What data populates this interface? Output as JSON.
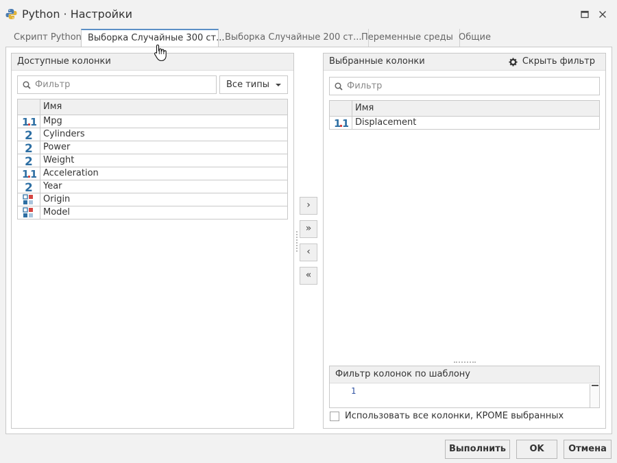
{
  "window": {
    "title": "Python · Настройки"
  },
  "tabs": [
    {
      "label": "Скрипт Python"
    },
    {
      "label": "Выборка Случайные 300 ст..."
    },
    {
      "label": "Выборка Случайные 200 ст..."
    },
    {
      "label": "Переменные среды"
    },
    {
      "label": "Общие"
    }
  ],
  "available": {
    "title": "Доступные колонки",
    "filter_placeholder": "Фильтр",
    "type_select": "Все типы",
    "column_header": "Имя",
    "columns": [
      {
        "name": "Mpg",
        "type_icon": "decimal-type-icon"
      },
      {
        "name": "Cylinders",
        "type_icon": "integer-type-icon"
      },
      {
        "name": "Power",
        "type_icon": "integer-type-icon"
      },
      {
        "name": "Weight",
        "type_icon": "integer-type-icon"
      },
      {
        "name": "Acceleration",
        "type_icon": "decimal-type-icon"
      },
      {
        "name": "Year",
        "type_icon": "integer-type-icon"
      },
      {
        "name": "Origin",
        "type_icon": "nominal-type-icon"
      },
      {
        "name": "Model",
        "type_icon": "nominal-type-icon"
      }
    ]
  },
  "move_buttons": {
    "add": "›",
    "add_all": "»",
    "remove": "‹",
    "remove_all": "«"
  },
  "selected": {
    "title": "Выбранные колонки",
    "hide_filter": "Скрыть фильтр",
    "filter_placeholder": "Фильтр",
    "column_header": "Имя",
    "columns": [
      {
        "name": "Displacement",
        "type_icon": "decimal-type-icon"
      }
    ],
    "pattern_title": "Фильтр колонок по шаблону",
    "pattern_line_number": "1",
    "exclude_label": "Использовать все колонки, КРОМЕ выбранных"
  },
  "footer": {
    "run": "Выполнить",
    "ok": "OK",
    "cancel": "Отмена"
  },
  "colors": {
    "accent": "#5b8fc6",
    "decimal_blue": "#2e6fa3",
    "decimal_red": "#d64541",
    "nominal_blue": "#2e6fa3",
    "nominal_red": "#d64541",
    "nominal_light": "#a9c4dc"
  }
}
